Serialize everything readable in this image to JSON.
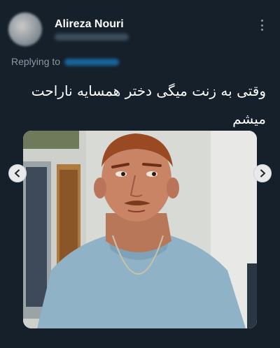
{
  "author": {
    "display_name": "Alireza Nouri"
  },
  "reply": {
    "label": "Replying to"
  },
  "tweet": {
    "text": "وقتی به زنت میگی دختر همسایه ناراحت میشم"
  },
  "colors": {
    "background": "#15202b",
    "muted_text": "#8b98a5",
    "link": "#1d9bf0"
  },
  "icons": {
    "more": "more-vertical-icon",
    "prev": "chevron-left-icon",
    "next": "chevron-right-icon"
  }
}
